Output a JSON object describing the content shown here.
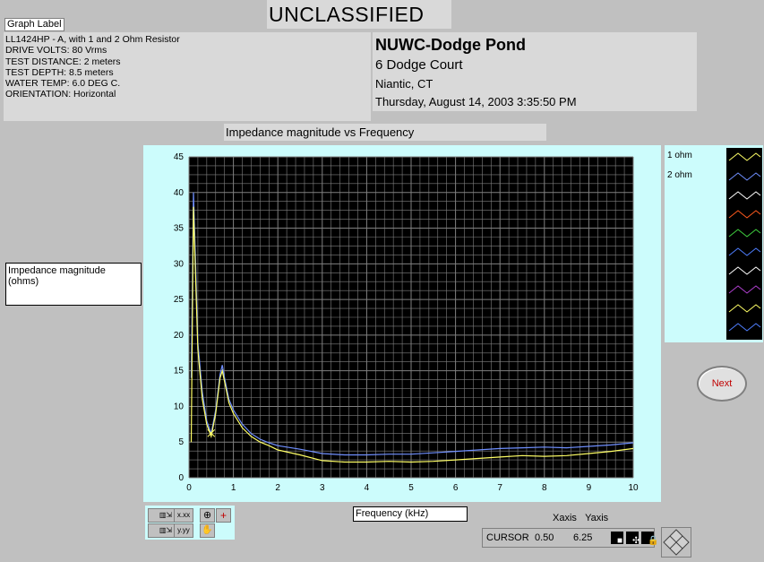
{
  "classification": "UNCLASSIFIED",
  "graph_label_tag": "Graph Label",
  "test_info": [
    "LL1424HP - A,  with 1 and 2  Ohm Resistor",
    "DRIVE VOLTS: 80 Vrms",
    "TEST DISTANCE: 2 meters",
    "TEST DEPTH: 8.5 meters",
    "WATER TEMP: 6.0 DEG C.",
    "ORIENTATION: Horizontal"
  ],
  "org": {
    "name": "NUWC-Dodge Pond",
    "address": "6 Dodge Court",
    "city": "Niantic, CT",
    "datetime": "Thursday, August 14, 2003 3:35:50 PM"
  },
  "plot_title": "Impedance magnitude vs Frequency",
  "y_label": "Impedance magnitude (ohms)",
  "x_label": "Frequency (kHz)",
  "legend": [
    "1 ohm",
    "2 ohm"
  ],
  "next_label": "Next",
  "cursor": {
    "header_x": "Xaxis",
    "header_y": "Yaxis",
    "label": "CURSOR",
    "x": "0.50",
    "y": "6.25"
  },
  "palette": {
    "x_format": "x.xx",
    "y_format": "y.yy"
  },
  "colors": {
    "series_1ohm": "#ffff66",
    "series_2ohm": "#6f8fff",
    "grid": "#808080",
    "plot_bg": "#000000",
    "frame_bg": "#ccfcfc"
  },
  "chart_data": {
    "type": "line",
    "xlim": [
      0,
      10
    ],
    "ylim": [
      0,
      45
    ],
    "xticks": [
      0,
      1,
      2,
      3,
      4,
      5,
      6,
      7,
      8,
      9,
      10
    ],
    "yticks": [
      0,
      5,
      10,
      15,
      20,
      25,
      30,
      35,
      40,
      45
    ],
    "grid": true,
    "series": [
      {
        "name": "1 ohm",
        "color": "#ffff66",
        "x": [
          0.05,
          0.1,
          0.15,
          0.2,
          0.3,
          0.4,
          0.5,
          0.6,
          0.7,
          0.75,
          0.8,
          0.9,
          1.0,
          1.2,
          1.4,
          1.6,
          1.8,
          2.0,
          2.5,
          3.0,
          3.5,
          4.0,
          4.5,
          5.0,
          5.5,
          6.0,
          6.5,
          7.0,
          7.5,
          8.0,
          8.5,
          9.0,
          9.5,
          10.0
        ],
        "y": [
          5,
          38,
          28,
          18,
          11,
          7.5,
          5.8,
          9,
          14,
          15,
          13.5,
          10.5,
          9,
          7,
          5.8,
          5,
          4.5,
          3.9,
          3.2,
          2.4,
          2.2,
          2.2,
          2.3,
          2.2,
          2.3,
          2.5,
          2.7,
          2.9,
          3.1,
          3.0,
          3.1,
          3.4,
          3.7,
          4.1
        ]
      },
      {
        "name": "2 ohm",
        "color": "#6f8fff",
        "x": [
          0.05,
          0.1,
          0.15,
          0.2,
          0.3,
          0.4,
          0.5,
          0.6,
          0.7,
          0.75,
          0.8,
          0.9,
          1.0,
          1.2,
          1.4,
          1.6,
          1.8,
          2.0,
          2.5,
          3.0,
          3.5,
          4.0,
          4.5,
          5.0,
          5.5,
          6.0,
          6.5,
          7.0,
          7.5,
          8.0,
          8.5,
          9.0,
          9.5,
          10.0
        ],
        "y": [
          14,
          40,
          30,
          19,
          12,
          8,
          6.2,
          9.5,
          14.5,
          15.8,
          14,
          11,
          9.5,
          7.5,
          6.2,
          5.4,
          4.9,
          4.5,
          4.0,
          3.4,
          3.2,
          3.2,
          3.3,
          3.3,
          3.5,
          3.7,
          3.9,
          4.1,
          4.2,
          4.3,
          4.2,
          4.4,
          4.6,
          4.9
        ]
      }
    ]
  }
}
